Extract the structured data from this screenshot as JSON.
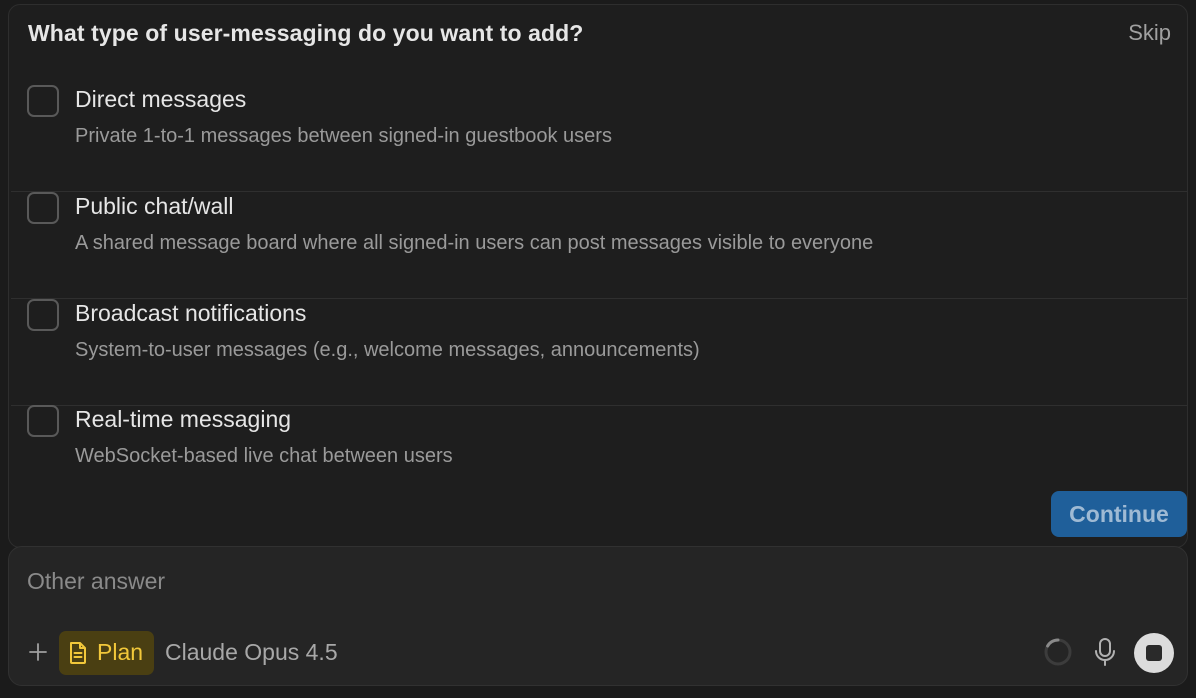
{
  "question": {
    "title": "What type of user-messaging do you want to add?",
    "skip_label": "Skip"
  },
  "options": [
    {
      "title": "Direct messages",
      "description": "Private 1-to-1 messages between signed-in guestbook users",
      "checked": false
    },
    {
      "title": "Public chat/wall",
      "description": "A shared message board where all signed-in users can post messages visible to everyone",
      "checked": false
    },
    {
      "title": "Broadcast notifications",
      "description": "System-to-user messages (e.g., welcome messages, announcements)",
      "checked": false
    },
    {
      "title": "Real-time messaging",
      "description": "WebSocket-based live chat between users",
      "checked": false
    }
  ],
  "continue_label": "Continue",
  "composer": {
    "placeholder": "Other answer",
    "value": "",
    "mode_label": "Plan",
    "model_label": "Claude Opus 4.5"
  },
  "icons": {
    "add": "plus-icon",
    "mode": "document-icon",
    "status": "loading-spinner-icon",
    "voice": "microphone-icon",
    "stop": "stop-icon"
  },
  "colors": {
    "accent": "#1f5f9a",
    "plan_bg": "#4a3f12",
    "plan_fg": "#f2c83a"
  }
}
